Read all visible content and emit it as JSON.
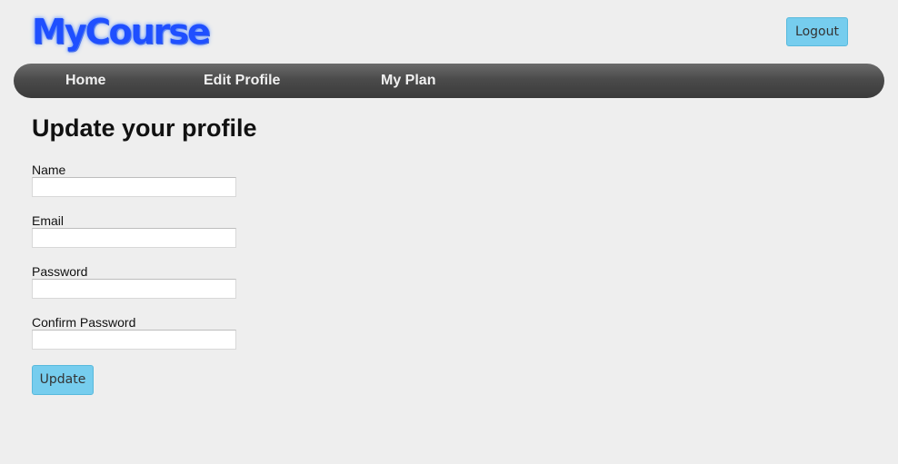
{
  "header": {
    "logo_text": "MyCourse",
    "logout_label": "Logout"
  },
  "nav": {
    "items": [
      {
        "label": "Home"
      },
      {
        "label": "Edit Profile"
      },
      {
        "label": "My Plan"
      }
    ]
  },
  "main": {
    "title": "Update your profile",
    "fields": {
      "name": {
        "label": "Name",
        "value": ""
      },
      "email": {
        "label": "Email",
        "value": ""
      },
      "password": {
        "label": "Password",
        "value": ""
      },
      "confirm_password": {
        "label": "Confirm Password",
        "value": ""
      }
    },
    "submit_label": "Update"
  },
  "colors": {
    "accent_button": "#76cdee",
    "logo": "#1f4fff",
    "navbar": "#4b4b4b",
    "background": "#eeeeee"
  }
}
